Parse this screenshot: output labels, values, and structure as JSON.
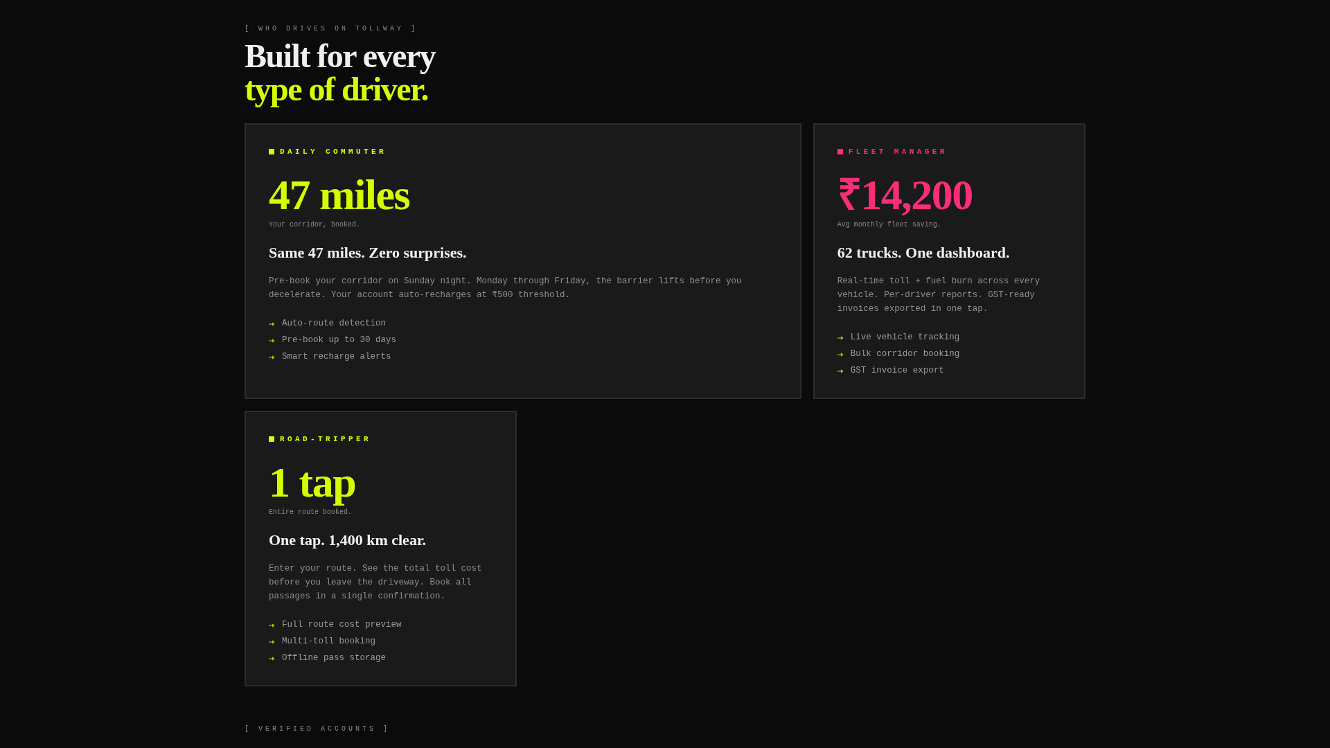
{
  "section": {
    "eyebrow": "[ WHO DRIVES ON TOLLWAY ]",
    "heading": [
      {
        "text": "Built for every",
        "accent": false
      },
      {
        "text": "type of driver.",
        "accent": true
      }
    ]
  },
  "cards": [
    {
      "label": "DAILY COMMUTER",
      "color": "#d4ff00",
      "wide": true,
      "stat": "47 miles",
      "stat_caption": "Your corridor, booked.",
      "title": "Same 47 miles. Zero surprises.",
      "body": "Pre-book your corridor on Sunday night. Monday through Friday, the barrier lifts before you decelerate. Your account auto-recharges at ₹500 threshold.",
      "features": [
        "Auto-route detection",
        "Pre-book up to 30 days",
        "Smart recharge alerts"
      ]
    },
    {
      "label": "FLEET MANAGER",
      "color": "#ff2d78",
      "wide": false,
      "stat": "₹14,200",
      "stat_caption": "Avg monthly fleet saving.",
      "title": "62 trucks. One dashboard.",
      "body": "Real-time toll + fuel burn across every vehicle. Per-driver reports. GST-ready invoices exported in one tap.",
      "features": [
        "Live vehicle tracking",
        "Bulk corridor booking",
        "GST invoice export"
      ]
    },
    {
      "label": "ROAD-TRIPPER",
      "color": "#d4ff00",
      "wide": false,
      "stat": "1 tap",
      "stat_caption": "Entire route booked.",
      "title": "One tap. 1,400 km clear.",
      "body": "Enter your route. See the total toll cost before you leave the driveway. Book all passages in a single confirmation.",
      "features": [
        "Full route cost preview",
        "Multi-toll booking",
        "Offline pass storage"
      ]
    }
  ],
  "next_section": {
    "eyebrow": "[ VERIFIED ACCOUNTS ]"
  }
}
